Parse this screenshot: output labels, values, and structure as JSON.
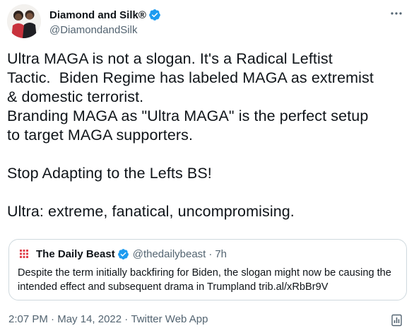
{
  "author": {
    "display_name": "Diamond and Silk®",
    "handle": "@DiamondandSilk",
    "verified_color": "#1d9bf0"
  },
  "tweet": {
    "text": "Ultra MAGA is not a slogan. It's a Radical Leftist\nTactic.  Biden Regime has labeled MAGA as extremist\n& domestic terrorist.\nBranding MAGA as \"Ultra MAGA\" is the perfect setup\nto target MAGA supporters.\n\nStop Adapting to the Lefts BS!\n\nUltra: extreme, fanatical, uncompromising."
  },
  "quote": {
    "name": "The Daily Beast",
    "handle": "@thedailybeast",
    "separator": "·",
    "time": "7h",
    "text": "Despite the term initially backfiring for Biden, the slogan might now be causing the intended effect and subsequent drama in Trumpland trib.al/xRbBr9V",
    "brand_color": "#e0414b"
  },
  "meta": {
    "time": "2:07 PM",
    "sep1": " · ",
    "date": "May 14, 2022",
    "sep2": " · ",
    "source": "Twitter Web App"
  },
  "icons": {
    "more": "more-horizontal-icon",
    "verified": "verified-badge-icon",
    "analytics": "analytics-icon"
  },
  "colors": {
    "text": "#0f1419",
    "secondary": "#536471",
    "border": "#cfd9de"
  }
}
